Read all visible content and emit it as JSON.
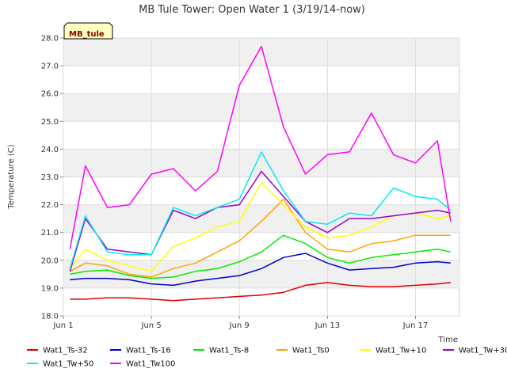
{
  "chart_data": {
    "type": "line",
    "title": "MB Tule Tower: Open Water 1 (3/19/14-now)",
    "xlabel": "Time",
    "ylabel": "Temperature (C)",
    "site_tag": "MB_tule",
    "x_ticks": [
      "Jun 1",
      "Jun 5",
      "Jun 9",
      "Jun 13",
      "Jun 17"
    ],
    "x_tick_days": [
      1,
      5,
      9,
      13,
      17
    ],
    "xlim": [
      1,
      19
    ],
    "ylim": [
      18.0,
      28.0
    ],
    "y_ticks": [
      "18.0",
      "19.0",
      "20.0",
      "21.0",
      "22.0",
      "23.0",
      "24.0",
      "25.0",
      "26.0",
      "27.0",
      "28.0"
    ],
    "grid": true,
    "legend_position": "bottom",
    "x_day": [
      1.3,
      2.0,
      3.0,
      4.0,
      5.0,
      6.0,
      7.0,
      8.0,
      9.0,
      10.0,
      11.0,
      12.0,
      13.0,
      14.0,
      15.0,
      16.0,
      17.0,
      18.0,
      18.6
    ],
    "series": [
      {
        "name": "Wat1_Ts-32",
        "color": "#dd0000",
        "values": [
          18.6,
          18.6,
          18.65,
          18.65,
          18.6,
          18.55,
          18.6,
          18.65,
          18.7,
          18.75,
          18.85,
          19.1,
          19.2,
          19.1,
          19.05,
          19.05,
          19.1,
          19.15,
          19.2
        ]
      },
      {
        "name": "Wat1_Ts-16",
        "color": "#0000cc",
        "values": [
          19.3,
          19.35,
          19.35,
          19.3,
          19.15,
          19.1,
          19.25,
          19.35,
          19.45,
          19.7,
          20.1,
          20.25,
          19.9,
          19.65,
          19.7,
          19.75,
          19.9,
          19.95,
          19.9
        ]
      },
      {
        "name": "Wat1_Ts-8",
        "color": "#00ee00",
        "values": [
          19.5,
          19.6,
          19.65,
          19.45,
          19.35,
          19.4,
          19.6,
          19.7,
          19.95,
          20.3,
          20.9,
          20.6,
          20.1,
          19.9,
          20.1,
          20.2,
          20.3,
          20.4,
          20.3
        ]
      },
      {
        "name": "Wat1_Ts0",
        "color": "#ffa500",
        "values": [
          19.6,
          19.9,
          19.8,
          19.5,
          19.4,
          19.7,
          19.9,
          20.3,
          20.7,
          21.4,
          22.2,
          21.0,
          20.4,
          20.3,
          20.6,
          20.7,
          20.9,
          20.9,
          20.9
        ]
      },
      {
        "name": "Wat1_Tw+10",
        "color": "#ffff00",
        "values": [
          19.7,
          20.4,
          20.0,
          19.8,
          19.6,
          20.5,
          20.8,
          21.2,
          21.4,
          22.8,
          22.0,
          21.2,
          20.8,
          20.9,
          21.2,
          21.6,
          21.7,
          21.5,
          21.6
        ]
      },
      {
        "name": "Wat1_Tw+30",
        "color": "#9900cc",
        "values": [
          19.6,
          21.5,
          20.4,
          20.3,
          20.2,
          21.8,
          21.5,
          21.9,
          22.0,
          23.2,
          22.3,
          21.4,
          21.0,
          21.5,
          21.5,
          21.6,
          21.7,
          21.8,
          21.7
        ]
      },
      {
        "name": "Wat1_Tw+50",
        "color": "#00eeee",
        "values": [
          19.7,
          21.6,
          20.3,
          20.2,
          20.2,
          21.9,
          21.6,
          21.9,
          22.2,
          23.9,
          22.5,
          21.4,
          21.3,
          21.7,
          21.6,
          22.6,
          22.3,
          22.2,
          21.8
        ]
      },
      {
        "name": "Wat1_Tw100",
        "color": "#ff00ff",
        "values": [
          20.4,
          23.4,
          21.9,
          22.0,
          23.1,
          23.3,
          22.5,
          23.2,
          26.3,
          27.7,
          24.8,
          23.1,
          23.8,
          23.9,
          25.3,
          23.8,
          23.5,
          24.3,
          21.4
        ]
      }
    ]
  }
}
